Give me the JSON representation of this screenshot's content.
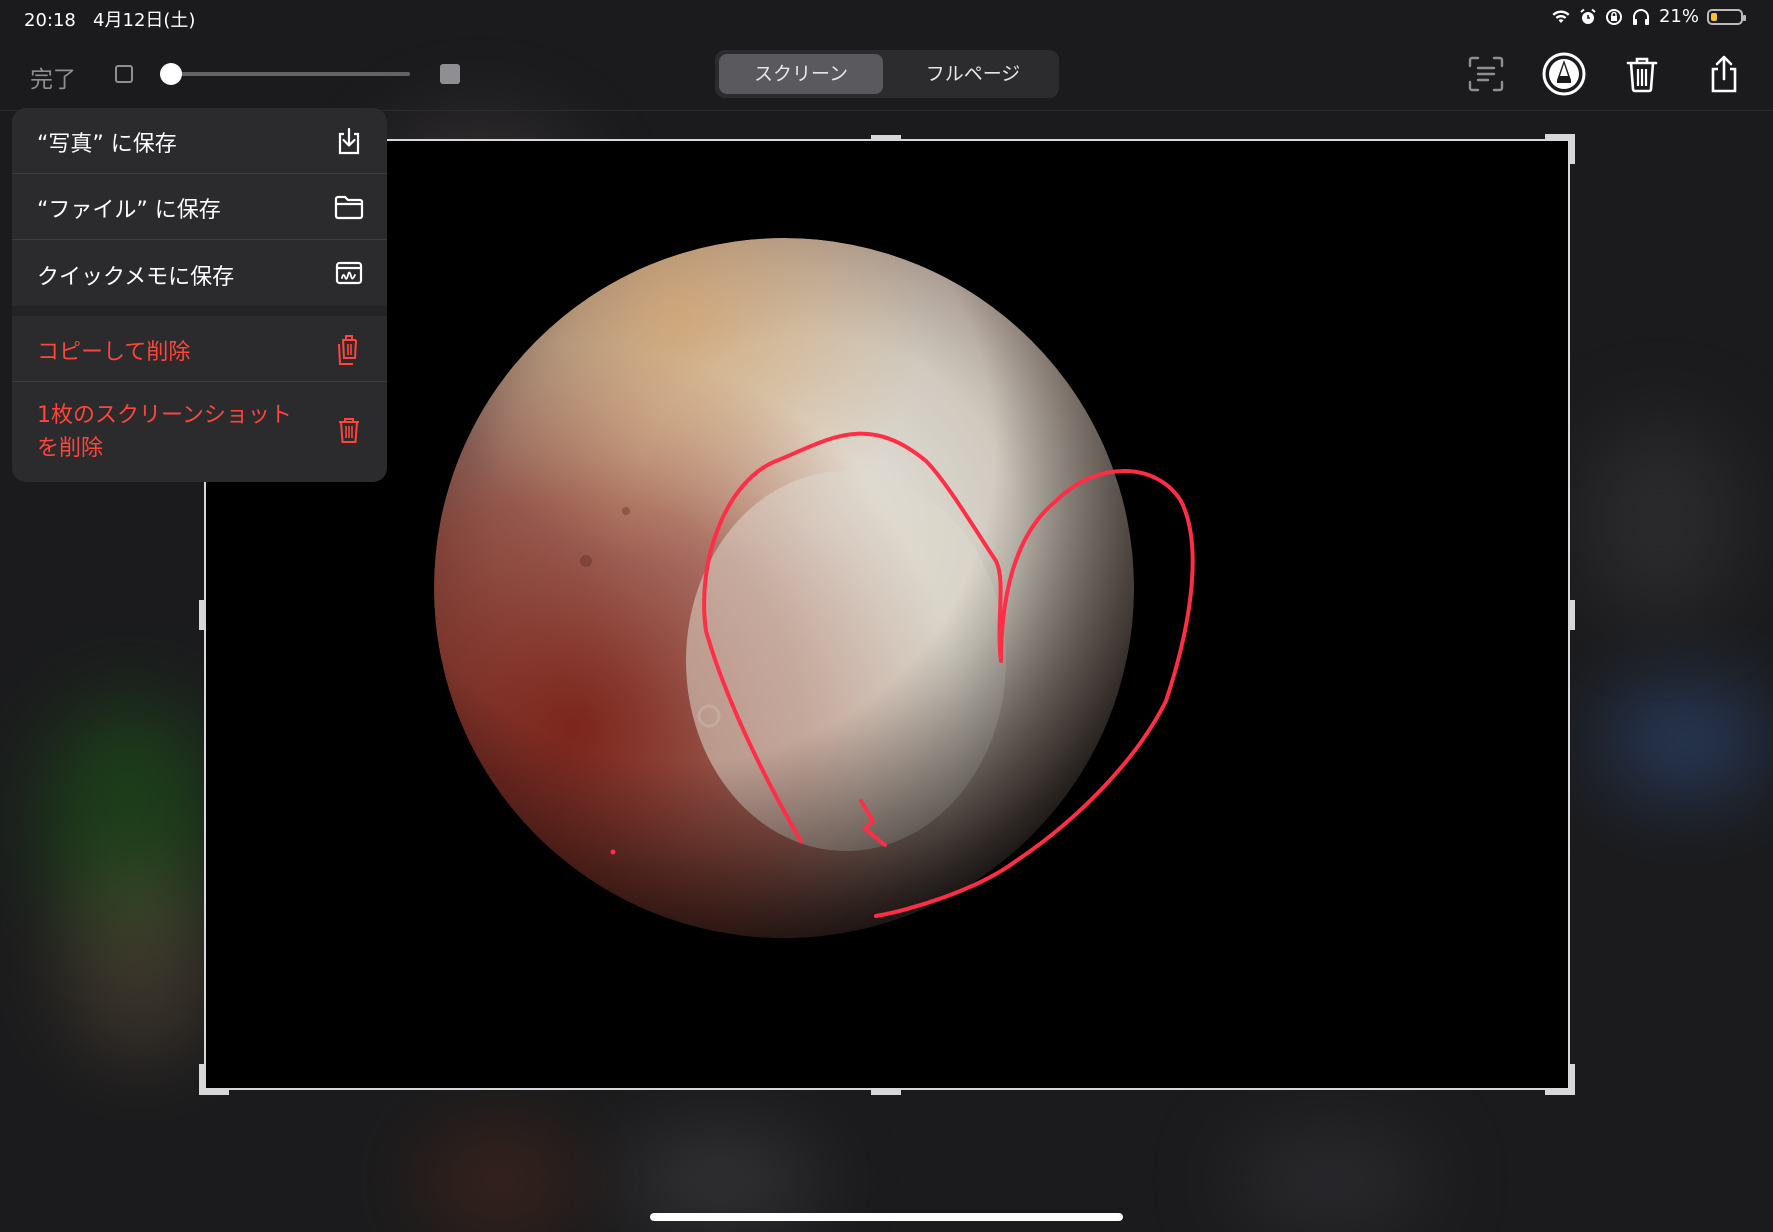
{
  "status_bar": {
    "time": "20:18",
    "date": "4月12日(土)",
    "battery_percent": "21%",
    "battery_level": 0.21
  },
  "toolbar": {
    "done_label": "完了",
    "opacity_slider_value": 0.0,
    "tabs": [
      {
        "label": "スクリーン",
        "selected": true
      },
      {
        "label": "フルページ",
        "selected": false
      }
    ]
  },
  "menu": {
    "items": [
      {
        "label": "“写真” に保存",
        "icon": "save-to-photos-icon",
        "destructive": false
      },
      {
        "label": "“ファイル” に保存",
        "icon": "folder-icon",
        "destructive": false
      },
      {
        "label": "クイックメモに保存",
        "icon": "quick-note-icon",
        "destructive": false
      },
      {
        "label": "コピーして削除",
        "icon": "copy-delete-icon",
        "destructive": true
      },
      {
        "label_line1": "1枚のスクリーンショット",
        "label_line2": "を削除",
        "icon": "trash-icon",
        "destructive": true
      }
    ]
  },
  "colors": {
    "accent_destructive": "#ff453a",
    "annotation_stroke": "#ff2d45",
    "menu_background": "#2b2b2d",
    "toolbar_text": "#8e8e93"
  }
}
